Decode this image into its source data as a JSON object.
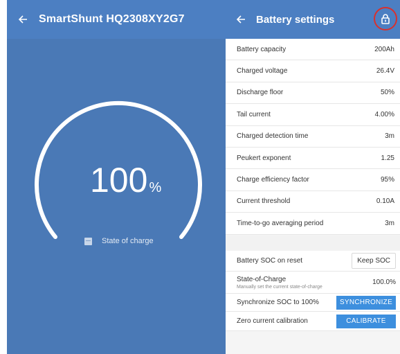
{
  "left": {
    "title": "SmartShunt HQ2308XY2G7",
    "soc_value": "100",
    "soc_unit": "%",
    "soc_label": "State of charge"
  },
  "right": {
    "title": "Battery settings",
    "settings": [
      {
        "label": "Battery capacity",
        "value": "200Ah"
      },
      {
        "label": "Charged voltage",
        "value": "26.4V"
      },
      {
        "label": "Discharge floor",
        "value": "50%"
      },
      {
        "label": "Tail current",
        "value": "4.00%"
      },
      {
        "label": "Charged detection time",
        "value": "3m"
      },
      {
        "label": "Peukert exponent",
        "value": "1.25"
      },
      {
        "label": "Charge efficiency factor",
        "value": "95%"
      },
      {
        "label": "Current threshold",
        "value": "0.10A"
      },
      {
        "label": "Time-to-go averaging period",
        "value": "3m"
      }
    ],
    "soc_on_reset_label": "Battery SOC on reset",
    "soc_on_reset_value": "Keep SOC",
    "state_of_charge_label": "State-of-Charge",
    "state_of_charge_sub": "Manually set the current state-of-charge",
    "state_of_charge_value": "100.0%",
    "sync_label": "Synchronize SOC to 100%",
    "sync_button": "SYNCHRONIZE",
    "zero_label": "Zero current calibration",
    "zero_button": "CALIBRATE"
  },
  "colors": {
    "header_blue": "#4c7fc2",
    "panel_blue": "#4a79b6",
    "button_blue": "#3d8fde",
    "lock_highlight": "#d8302d"
  },
  "icons": [
    "back-arrow-icon",
    "lock-icon",
    "battery-icon"
  ]
}
